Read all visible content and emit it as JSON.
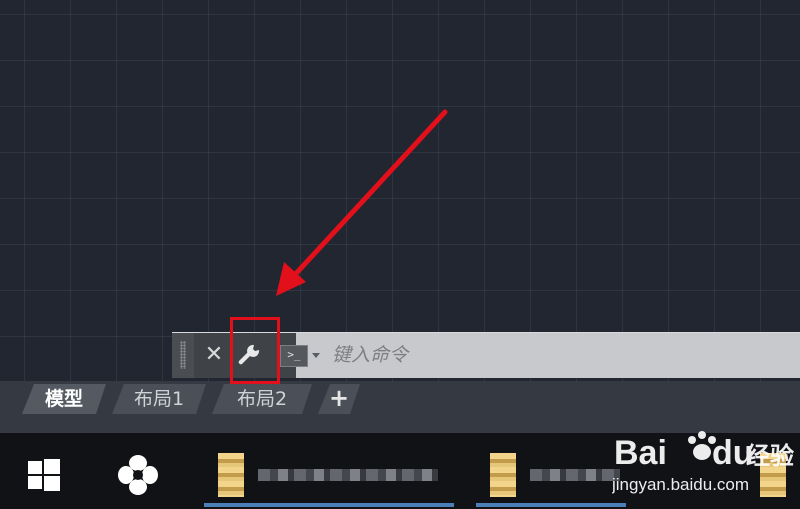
{
  "command_line": {
    "close_label": "✕",
    "prompt_label": ">_",
    "input_placeholder": "键入命令"
  },
  "layout_tabs": [
    {
      "label": "模型",
      "active": true
    },
    {
      "label": "布局1",
      "active": false
    },
    {
      "label": "布局2",
      "active": false
    }
  ],
  "add_tab_label": "+",
  "icons": {
    "close": "close-icon",
    "settings": "wrench-icon",
    "prompt": "command-prompt-icon",
    "dropdown": "chevron-down-icon",
    "windows": "windows-logo-icon",
    "app": "fan-icon"
  },
  "annotation": {
    "highlight_color": "#e2101a",
    "arrow_color": "#e2101a"
  },
  "watermark": {
    "brand": "Bai du 经验",
    "url": "jingyan.baidu.com"
  },
  "colors": {
    "canvas_bg": "#212631",
    "command_bar_bg": "#c7c9cc",
    "taskbar_bg": "#101216",
    "taskbar_accent": "#4a7fb8"
  }
}
